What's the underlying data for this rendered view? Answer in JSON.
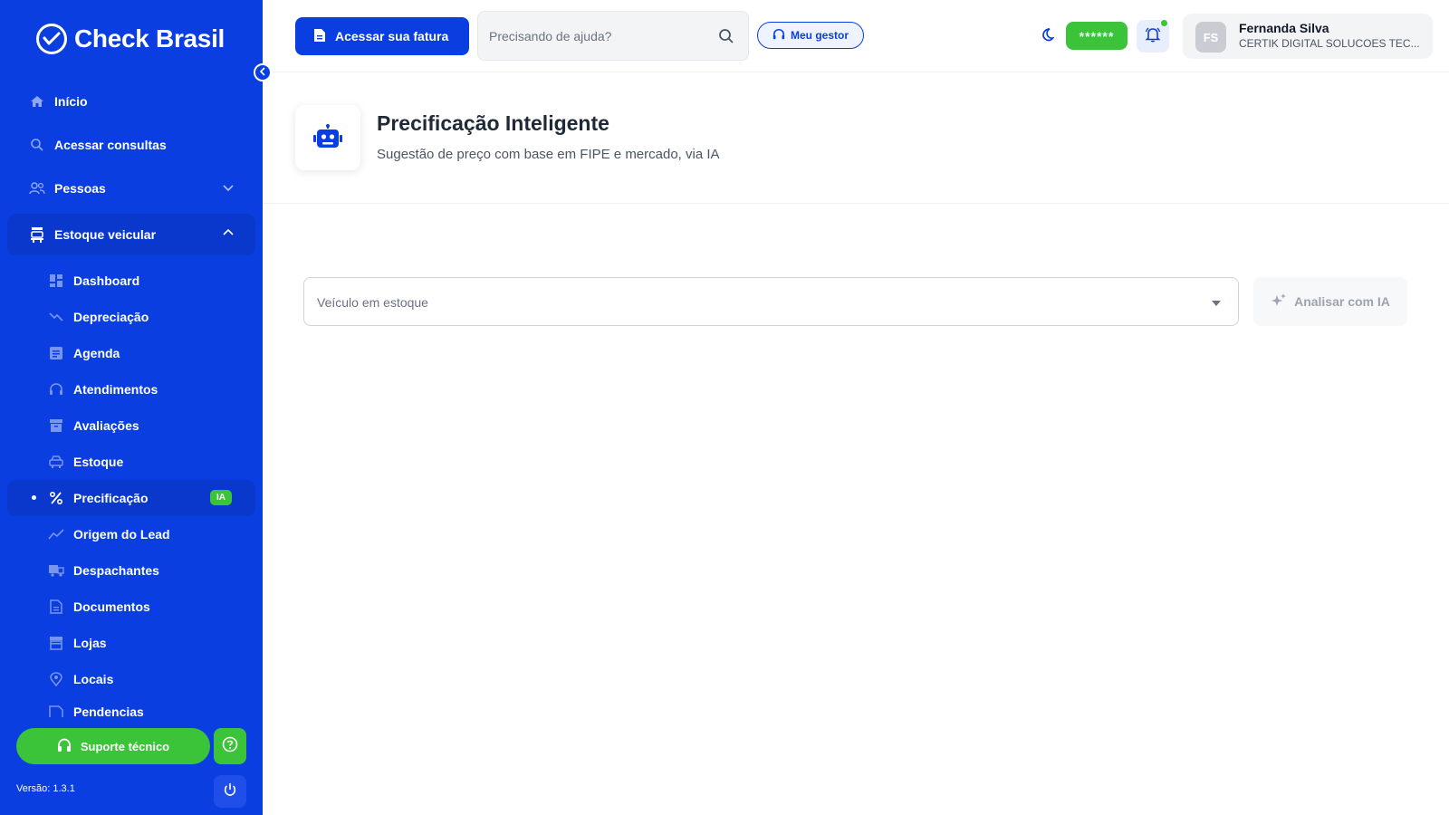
{
  "brand": {
    "name": "Check Brasil"
  },
  "nav": {
    "items": [
      {
        "label": "Início"
      },
      {
        "label": "Acessar consultas"
      },
      {
        "label": "Pessoas"
      },
      {
        "label": "Estoque veicular"
      }
    ],
    "sub_items": [
      {
        "label": "Dashboard"
      },
      {
        "label": "Depreciação"
      },
      {
        "label": "Agenda"
      },
      {
        "label": "Atendimentos"
      },
      {
        "label": "Avaliações"
      },
      {
        "label": "Estoque"
      },
      {
        "label": "Precificação",
        "badge": "IA"
      },
      {
        "label": "Origem do Lead"
      },
      {
        "label": "Despachantes"
      },
      {
        "label": "Documentos"
      },
      {
        "label": "Lojas"
      },
      {
        "label": "Locais"
      },
      {
        "label": "Pendencias"
      }
    ]
  },
  "footer": {
    "support_label": "Suporte técnico",
    "version": "Versão: 1.3.1"
  },
  "topbar": {
    "invoice_button": "Acessar sua fatura",
    "search_placeholder": "Precisando de ajuda?",
    "manager_button": "Meu gestor",
    "masked_value": "******",
    "user": {
      "initials": "FS",
      "name": "Fernanda Silva",
      "company": "CERTIK DIGITAL SOLUCOES TEC..."
    }
  },
  "page": {
    "title": "Precificação Inteligente",
    "subtitle": "Sugestão de preço com base em FIPE e mercado, via IA",
    "vehicle_select_placeholder": "Veículo em estoque",
    "analyze_button": "Analisar com IA"
  },
  "colors": {
    "primary": "#0a3ee0",
    "accent_green": "#3bc43a"
  }
}
